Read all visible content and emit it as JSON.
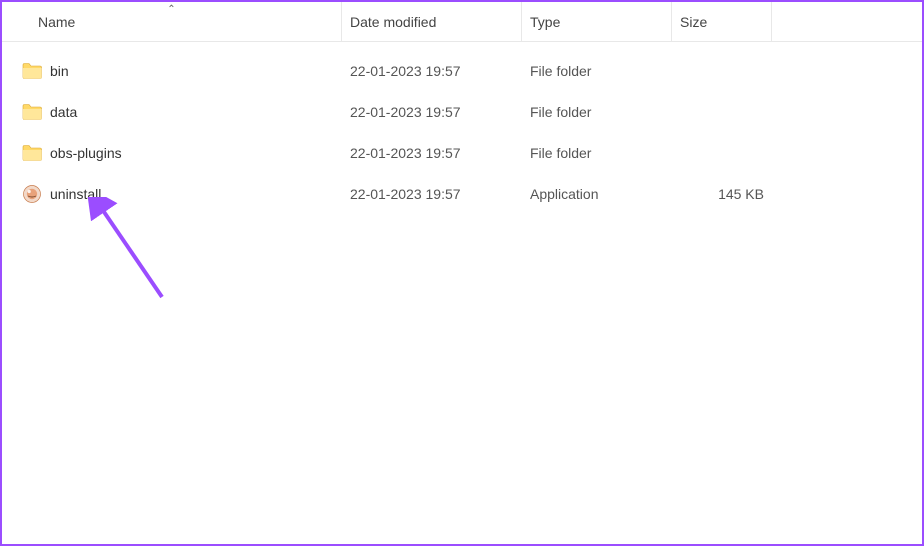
{
  "columns": {
    "name": "Name",
    "date": "Date modified",
    "type": "Type",
    "size": "Size"
  },
  "rows": [
    {
      "icon": "folder",
      "name": "bin",
      "date": "22-01-2023 19:57",
      "type": "File folder",
      "size": ""
    },
    {
      "icon": "folder",
      "name": "data",
      "date": "22-01-2023 19:57",
      "type": "File folder",
      "size": ""
    },
    {
      "icon": "folder",
      "name": "obs-plugins",
      "date": "22-01-2023 19:57",
      "type": "File folder",
      "size": ""
    },
    {
      "icon": "app",
      "name": "uninstall",
      "date": "22-01-2023 19:57",
      "type": "Application",
      "size": "145 KB"
    }
  ],
  "annotation": {
    "color": "#9b4dff"
  }
}
